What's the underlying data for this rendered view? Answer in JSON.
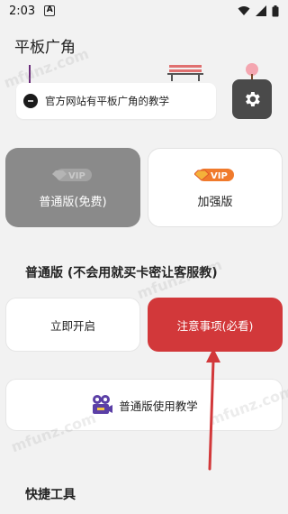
{
  "status_bar": {
    "time": "2:03",
    "badge": "A"
  },
  "header": {
    "title": "平板广角"
  },
  "notice": {
    "text": "官方网站有平板广角的教学"
  },
  "versions": {
    "free_label": "普通版(免费)",
    "pro_label": "加强版",
    "vip_text": "VIP"
  },
  "section": {
    "title": "普通版 (不会用就买卡密让客服教)"
  },
  "actions": {
    "start_label": "立即开启",
    "notes_label": "注意事项(必看)",
    "tutorial_label": "普通版使用教学"
  },
  "bottom": {
    "title": "快捷工具"
  },
  "watermark": {
    "text": "mfunz.com"
  },
  "colors": {
    "accent_red": "#d2383a",
    "free_card_gray": "#8a8a8a",
    "settings_dark": "#4a4a4a",
    "vip_orange": "#f07a2c",
    "tutorial_icon_purple": "#5b3fa6"
  }
}
